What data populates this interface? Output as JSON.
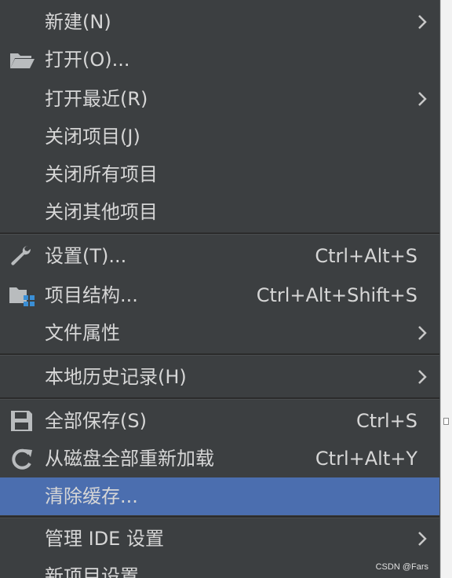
{
  "menu": {
    "items": [
      {
        "label": "新建(N)",
        "shortcut": "",
        "submenu": true
      },
      {
        "label": "打开(O)...",
        "shortcut": "",
        "submenu": false,
        "icon": "folder-open-icon"
      },
      {
        "label": "打开最近(R)",
        "shortcut": "",
        "submenu": true
      },
      {
        "label": "关闭项目(J)",
        "shortcut": "",
        "submenu": false
      },
      {
        "label": "关闭所有项目",
        "shortcut": "",
        "submenu": false
      },
      {
        "label": "关闭其他项目",
        "shortcut": "",
        "submenu": false
      },
      {
        "label": "设置(T)...",
        "shortcut": "Ctrl+Alt+S",
        "submenu": false,
        "icon": "wrench-icon"
      },
      {
        "label": "项目结构...",
        "shortcut": "Ctrl+Alt+Shift+S",
        "submenu": false,
        "icon": "project-structure-icon"
      },
      {
        "label": "文件属性",
        "shortcut": "",
        "submenu": true
      },
      {
        "label": "本地历史记录(H)",
        "shortcut": "",
        "submenu": true
      },
      {
        "label": "全部保存(S)",
        "shortcut": "Ctrl+S",
        "submenu": false,
        "icon": "save-icon"
      },
      {
        "label": "从磁盘全部重新加载",
        "shortcut": "Ctrl+Alt+Y",
        "submenu": false,
        "icon": "reload-icon"
      },
      {
        "label": "清除缓存...",
        "shortcut": "",
        "submenu": false,
        "selected": true
      },
      {
        "label": "管理 IDE 设置",
        "shortcut": "",
        "submenu": true
      },
      {
        "label": "新项目设置",
        "shortcut": "",
        "submenu": false
      }
    ]
  },
  "watermark": "CSDN @Fars",
  "colors": {
    "background": "#3c3f41",
    "text": "#d6d6d6",
    "selection": "#4b6eaf",
    "separator": "#2b2b2b"
  }
}
